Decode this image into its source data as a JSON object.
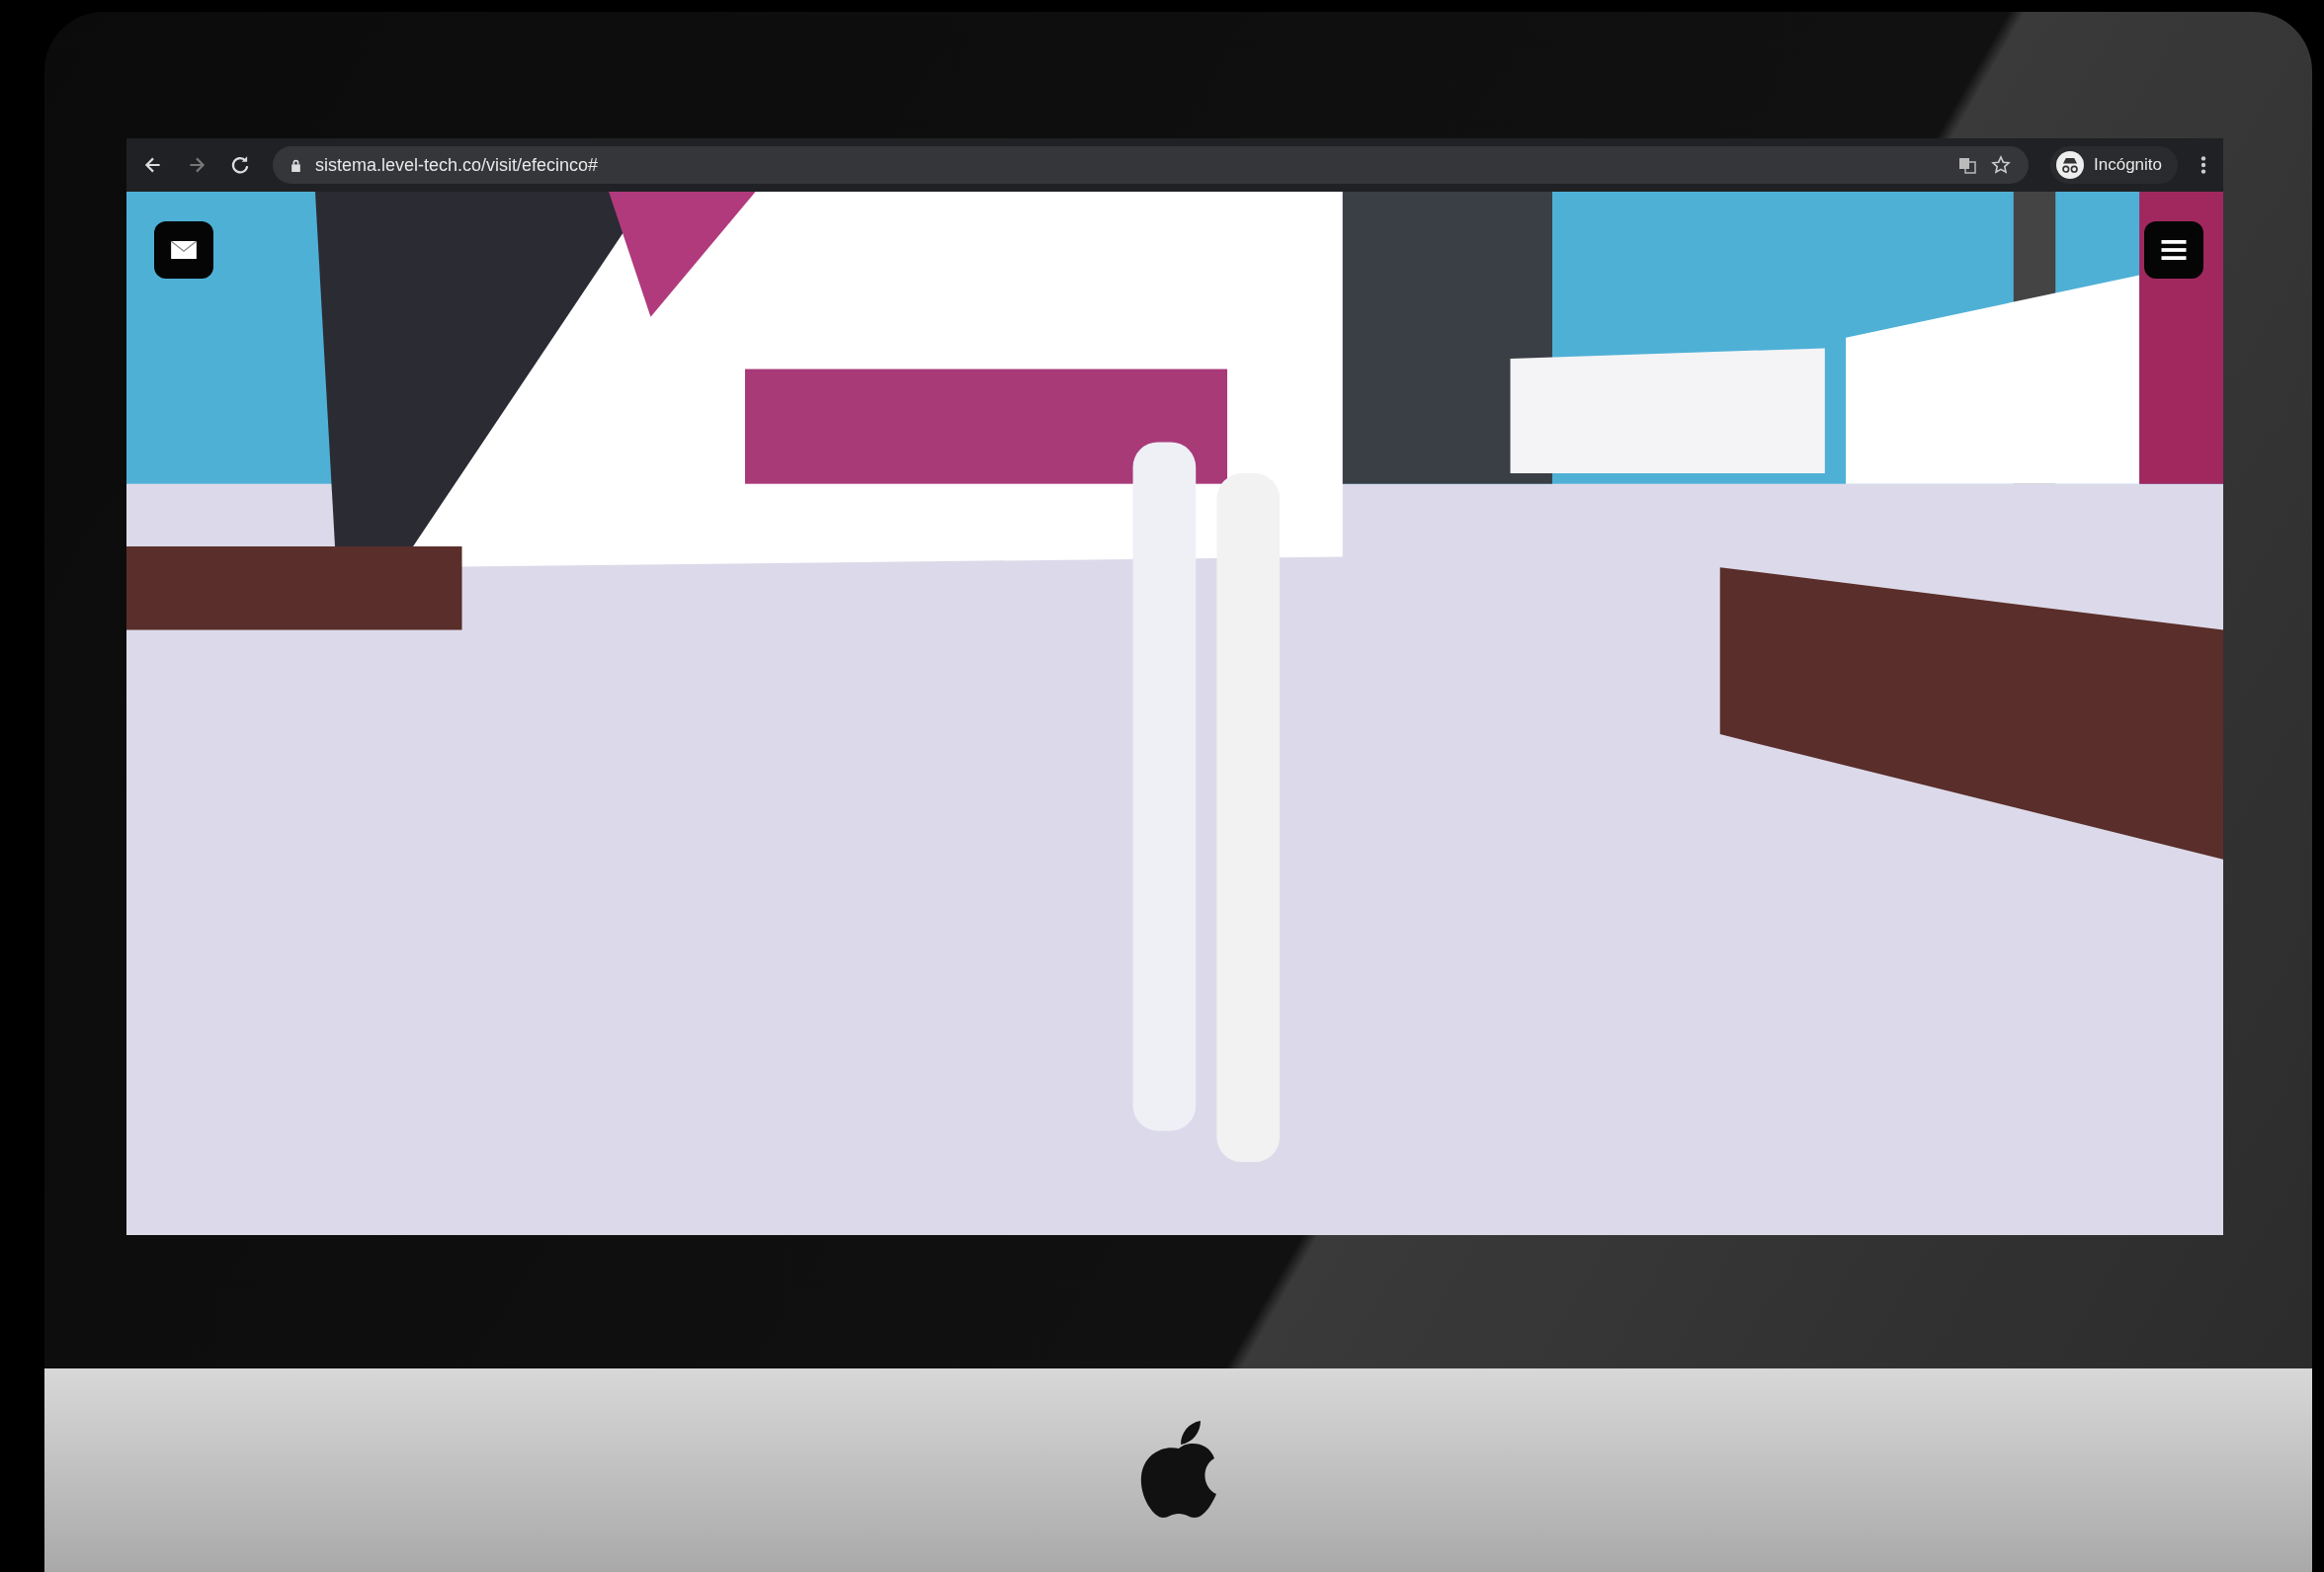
{
  "browser": {
    "url": "sistema.level-tech.co/visit/efecinco#",
    "profile_label": "Incógnito"
  }
}
